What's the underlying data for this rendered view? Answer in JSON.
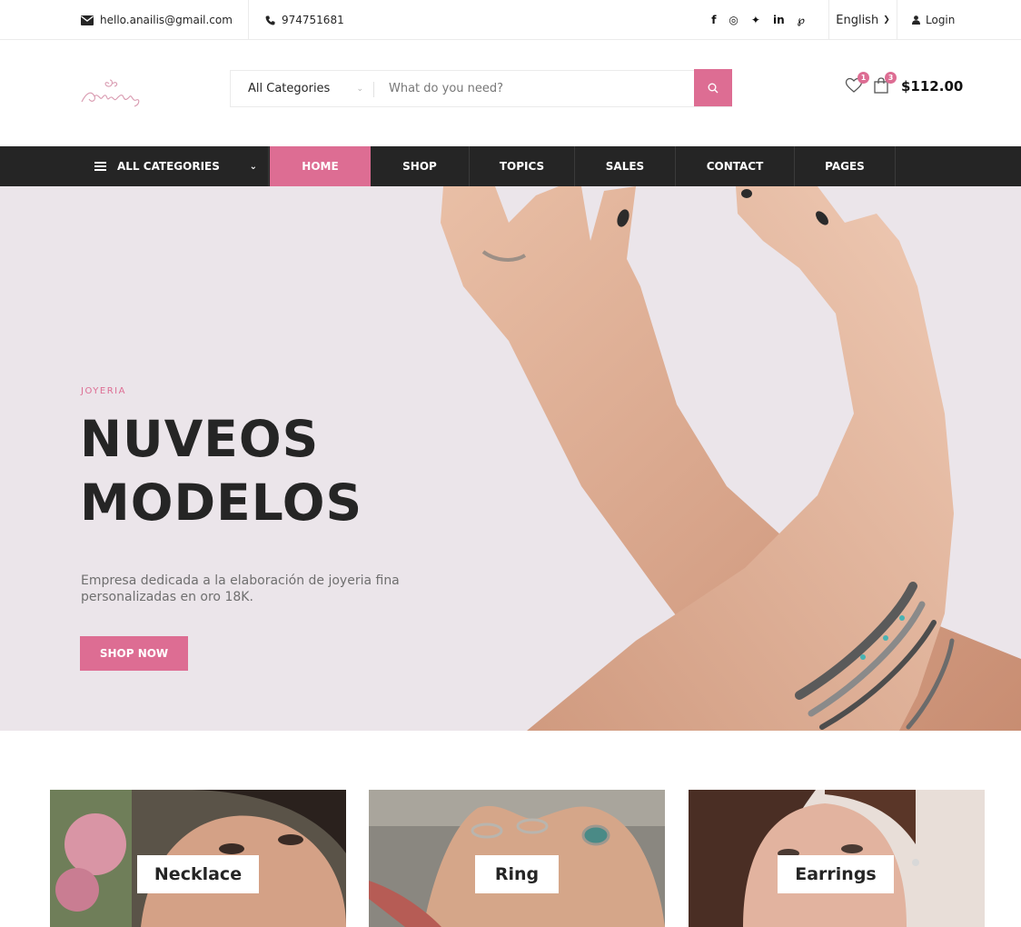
{
  "topbar": {
    "email": "hello.anailis@gmail.com",
    "phone": "974751681",
    "social": [
      "f",
      "◎",
      "✦",
      "in",
      "℘"
    ],
    "language": "English",
    "login": "Login"
  },
  "header": {
    "logo_text": "Anailis",
    "search": {
      "category": "All Categories",
      "placeholder": "What do you need?"
    },
    "wishlist_count": "1",
    "cart_count": "3",
    "cart_total": "$112.00"
  },
  "nav": {
    "all_categories": "ALL CATEGORIES",
    "items": [
      {
        "label": "HOME",
        "active": true
      },
      {
        "label": "SHOP"
      },
      {
        "label": "TOPICS"
      },
      {
        "label": "SALES"
      },
      {
        "label": "CONTACT"
      },
      {
        "label": "PAGES"
      }
    ]
  },
  "hero": {
    "eyebrow": "JOYERIA",
    "title_line1": "NUVEOS",
    "title_line2": "MODELOS",
    "description": "Empresa dedicada a la elaboración de joyeria fina personalizadas en oro 18K.",
    "button": "SHOP NOW"
  },
  "categories": [
    {
      "label": "Necklace"
    },
    {
      "label": "Ring"
    },
    {
      "label": "Earrings"
    }
  ],
  "colors": {
    "accent": "#dd6d93",
    "dark": "#252525",
    "hero_bg": "#ebe5ea"
  }
}
